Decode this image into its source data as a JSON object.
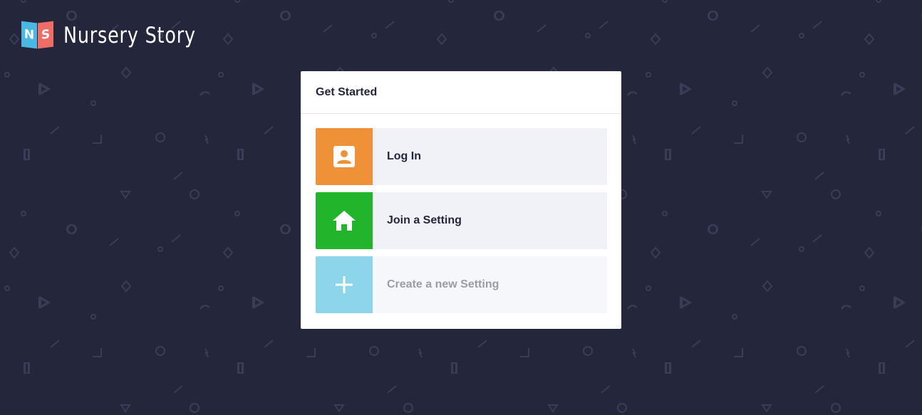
{
  "brand": {
    "mark_left": "N",
    "mark_right": "S",
    "name": "Nursery Story"
  },
  "card": {
    "title": "Get Started",
    "options": [
      {
        "label": "Log In",
        "icon": "user-badge-icon",
        "color": "#ef9136",
        "enabled": true
      },
      {
        "label": "Join a Setting",
        "icon": "home-icon",
        "color": "#22b42a",
        "enabled": true
      },
      {
        "label": "Create a new Setting",
        "icon": "plus-icon",
        "color": "#8dd5e8",
        "enabled": false
      }
    ]
  },
  "colors": {
    "background": "#24263b",
    "logo_n": "#4ab8e3",
    "logo_s": "#ee6e67",
    "card": "#ffffff",
    "option_bg": "#f1f2f7"
  }
}
